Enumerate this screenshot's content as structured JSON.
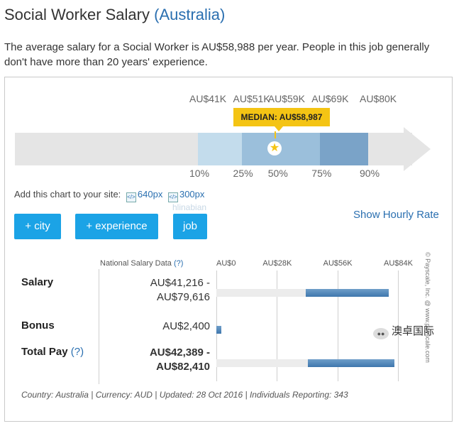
{
  "title": {
    "main": "Social Worker Salary",
    "country": "(Australia)"
  },
  "intro": "The average salary for a Social Worker is AU$58,988 per year. People in this job generally don't have more than 20 years' experience.",
  "chart_data": [
    {
      "type": "percentile-range",
      "percentiles": [
        "10%",
        "25%",
        "50%",
        "75%",
        "90%"
      ],
      "values": [
        41000,
        51000,
        59000,
        69000,
        80000
      ],
      "value_labels": [
        "AU$41K",
        "AU$51K",
        "AU$59K",
        "AU$69K",
        "AU$80K"
      ],
      "median_label": "MEDIAN: AU$58,987",
      "median_value": 58987,
      "band_colors": [
        "#c3dcec",
        "#9bbfdb",
        "#7aa3c8"
      ]
    },
    {
      "type": "range-bar",
      "header": "National Salary Data",
      "x_tick_labels": [
        "AU$0",
        "AU$28K",
        "AU$56K",
        "AU$84K"
      ],
      "x_ticks": [
        0,
        28000,
        56000,
        84000
      ],
      "rows": [
        {
          "label": "Salary",
          "help": "",
          "range_text": [
            "AU$41,216 -",
            "AU$79,616"
          ],
          "low": 41216,
          "high": 79616,
          "bold": false
        },
        {
          "label": "Bonus",
          "help": "",
          "range_text": [
            "AU$2,400",
            ""
          ],
          "low": 0,
          "high": 2400,
          "bold": false
        },
        {
          "label": "Total Pay",
          "help": "(?)",
          "range_text": [
            "AU$42,389 -",
            "AU$82,410"
          ],
          "low": 42389,
          "high": 82410,
          "bold": true
        }
      ]
    }
  ],
  "embed": {
    "prefix": "Add this chart to your site:",
    "link1": "640px",
    "link2": "300px",
    "icon": "embed-code-icon"
  },
  "buttons": {
    "city": "+ city",
    "experience": "+ experience",
    "job": "job"
  },
  "hourly_link": "Show Hourly Rate",
  "watermark": "hlinabian",
  "nsd_help": "(?)",
  "copyright": "© Payscale, Inc. @ www.payscale.com",
  "footer": "Country: Australia  |  Currency: AUD  |  Updated: 28 Oct 2016  |  Individuals Reporting: 343",
  "brand": "澳卓国际",
  "colors": {
    "accent": "#1ba3e6",
    "link": "#2a6fb0",
    "median": "#f4c414",
    "bar": "#3f77ad"
  }
}
